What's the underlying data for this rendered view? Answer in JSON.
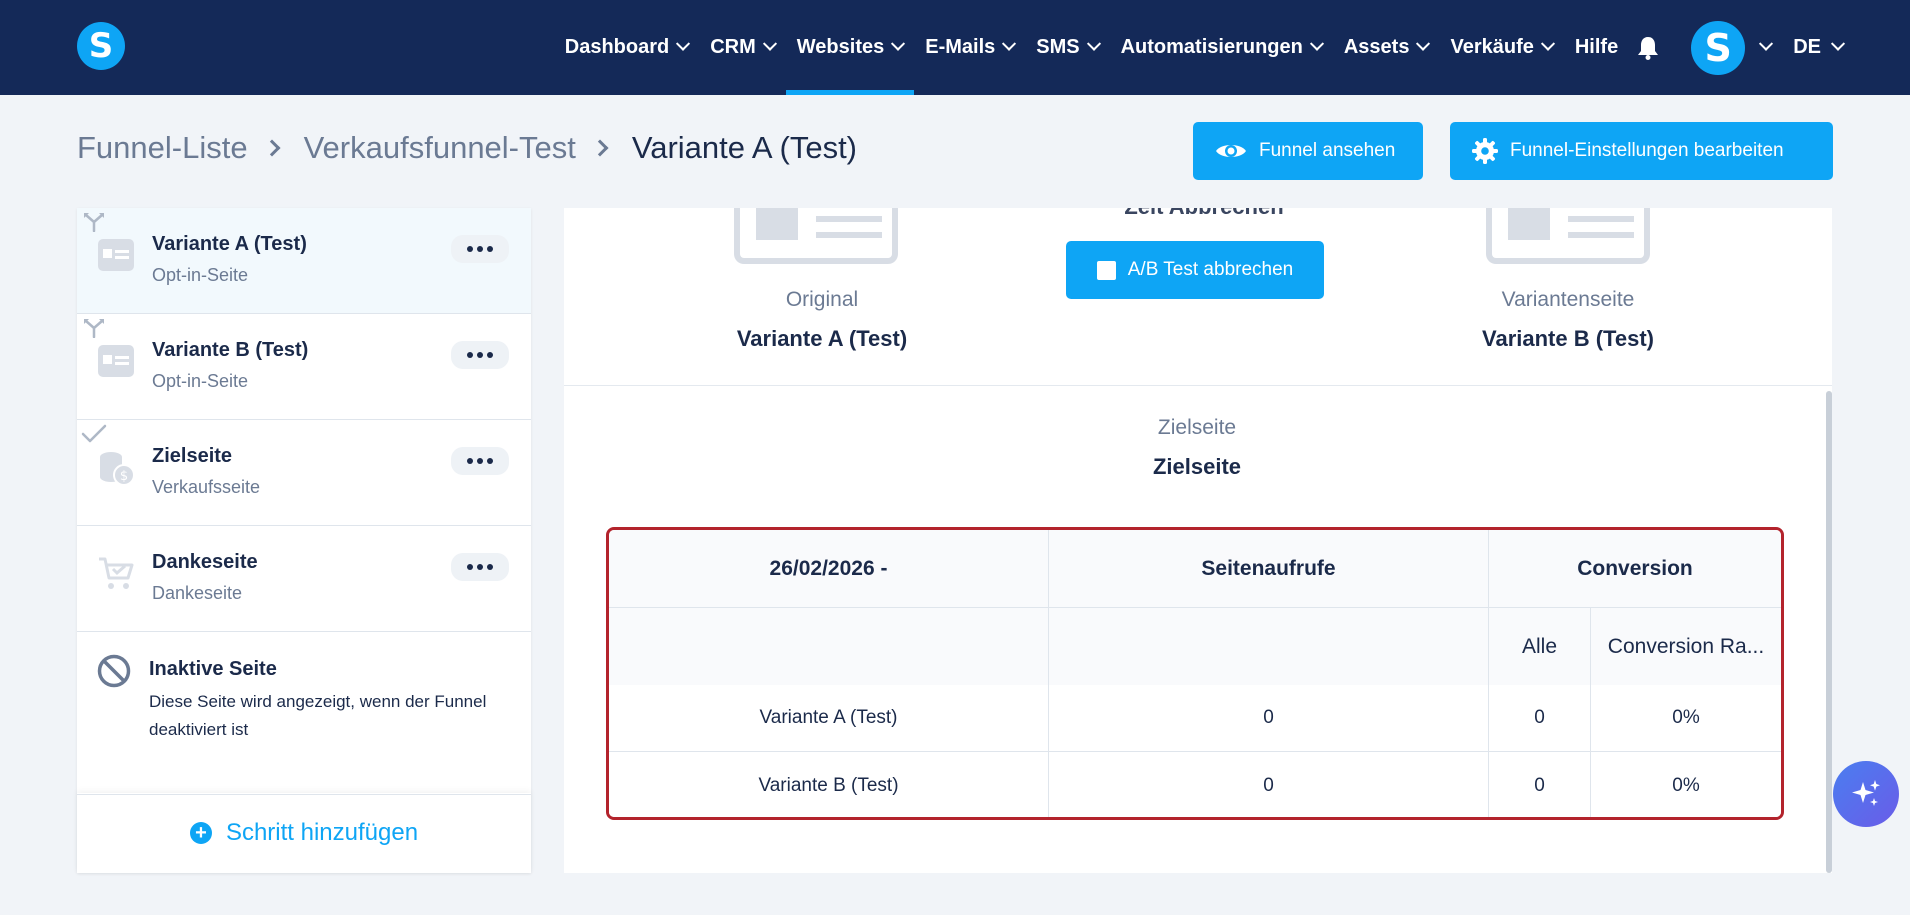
{
  "nav": {
    "items": [
      {
        "label": "Dashboard",
        "dropdown": true
      },
      {
        "label": "CRM",
        "dropdown": true
      },
      {
        "label": "Websites",
        "dropdown": true,
        "active": true
      },
      {
        "label": "E-Mails",
        "dropdown": true
      },
      {
        "label": "SMS",
        "dropdown": true
      },
      {
        "label": "Automatisierungen",
        "dropdown": true
      },
      {
        "label": "Assets",
        "dropdown": true
      },
      {
        "label": "Verkäufe",
        "dropdown": true
      },
      {
        "label": "Hilfe",
        "dropdown": false
      }
    ],
    "avatar_letter": "S",
    "logo_letter": "S",
    "language": "DE"
  },
  "breadcrumb": {
    "items": [
      "Funnel-Liste",
      "Verkaufsfunnel-Test",
      "Variante A (Test)"
    ]
  },
  "actions": {
    "view_funnel": "Funnel ansehen",
    "edit_settings": "Funnel-Einstellungen bearbeiten"
  },
  "sidebar": {
    "steps": [
      {
        "title": "Variante A (Test)",
        "subtitle": "Opt-in-Seite",
        "mini_icon": "split-icon",
        "icon": "optin-page-icon",
        "active": true
      },
      {
        "title": "Variante B (Test)",
        "subtitle": "Opt-in-Seite",
        "mini_icon": "split-icon",
        "icon": "optin-page-icon"
      },
      {
        "title": "Zielseite",
        "subtitle": "Verkaufsseite",
        "mini_icon": "check-icon",
        "icon": "coins-icon"
      },
      {
        "title": "Dankeseite",
        "subtitle": "Dankeseite",
        "icon": "cart-icon"
      }
    ],
    "inactive": {
      "title": "Inaktive Seite",
      "description": "Diese Seite wird angezeigt, wenn der Funnel deaktiviert ist"
    },
    "add_step": "Schritt hinzufügen"
  },
  "test": {
    "cut_off_heading": "Zeit Abbrechen",
    "abort_button": "A/B Test abbrechen",
    "original": {
      "label": "Original",
      "name": "Variante A (Test)"
    },
    "variant": {
      "label": "Variantenseite",
      "name": "Variante B (Test)"
    },
    "target": {
      "label": "Zielseite",
      "name": "Zielseite"
    }
  },
  "stats": {
    "date_header": "26/02/2026 -",
    "views_header": "Seitenaufrufe",
    "conversion_header": "Conversion",
    "all_header": "Alle",
    "rate_header": "Conversion Ra...",
    "rows": [
      {
        "name": "Variante A (Test)",
        "views": "0",
        "all": "0",
        "rate": "0%"
      },
      {
        "name": "Variante B (Test)",
        "views": "0",
        "all": "0",
        "rate": "0%"
      }
    ]
  },
  "colors": {
    "nav_bg": "#142958",
    "accent": "#0ea5f5",
    "highlight_border": "#b3232c"
  }
}
